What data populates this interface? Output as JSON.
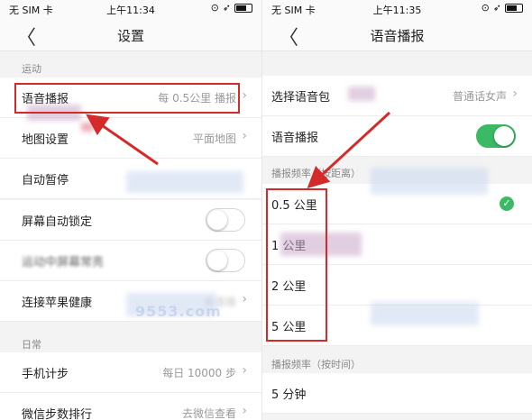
{
  "left": {
    "status": {
      "carrier": "无 SIM 卡",
      "time": "上午11:34"
    },
    "nav": {
      "back": "〈",
      "title": "设置"
    },
    "section_sport": "运动",
    "rows": {
      "voice": {
        "label": "语音播报",
        "value": "每 0.5公里 播报"
      },
      "map": {
        "label": "地图设置",
        "value": "平面地图"
      },
      "autopause": {
        "label": "自动暂停"
      },
      "screenlock": {
        "label": "屏幕自动锁定"
      },
      "keepon": {
        "label": "运动中屏幕常亮"
      },
      "health": {
        "label": "连接苹果健康",
        "value": "未连接"
      }
    },
    "section_daily": "日常",
    "daily": {
      "steps": {
        "label": "手机计步",
        "value": "每日 10000 步"
      },
      "wechat": {
        "label": "微信步数排行",
        "value": "去微信查看"
      }
    }
  },
  "right": {
    "status": {
      "carrier": "无 SIM 卡",
      "time": "上午11:35"
    },
    "nav": {
      "back": "〈",
      "title": "语音播报"
    },
    "rows": {
      "voicepack": {
        "label": "选择语音包",
        "value": "普通话女声"
      },
      "voice": {
        "label": "语音播报"
      }
    },
    "section_distance": "播报频率（按距离）",
    "distance_options": [
      "0.5 公里",
      "1 公里",
      "2 公里",
      "5 公里"
    ],
    "section_time": "播报频率（按时间）",
    "time_options": [
      "5 分钟"
    ]
  },
  "watermark": "9553.com",
  "colors": {
    "accent": "#3cb964",
    "highlight": "#d42a2a"
  }
}
